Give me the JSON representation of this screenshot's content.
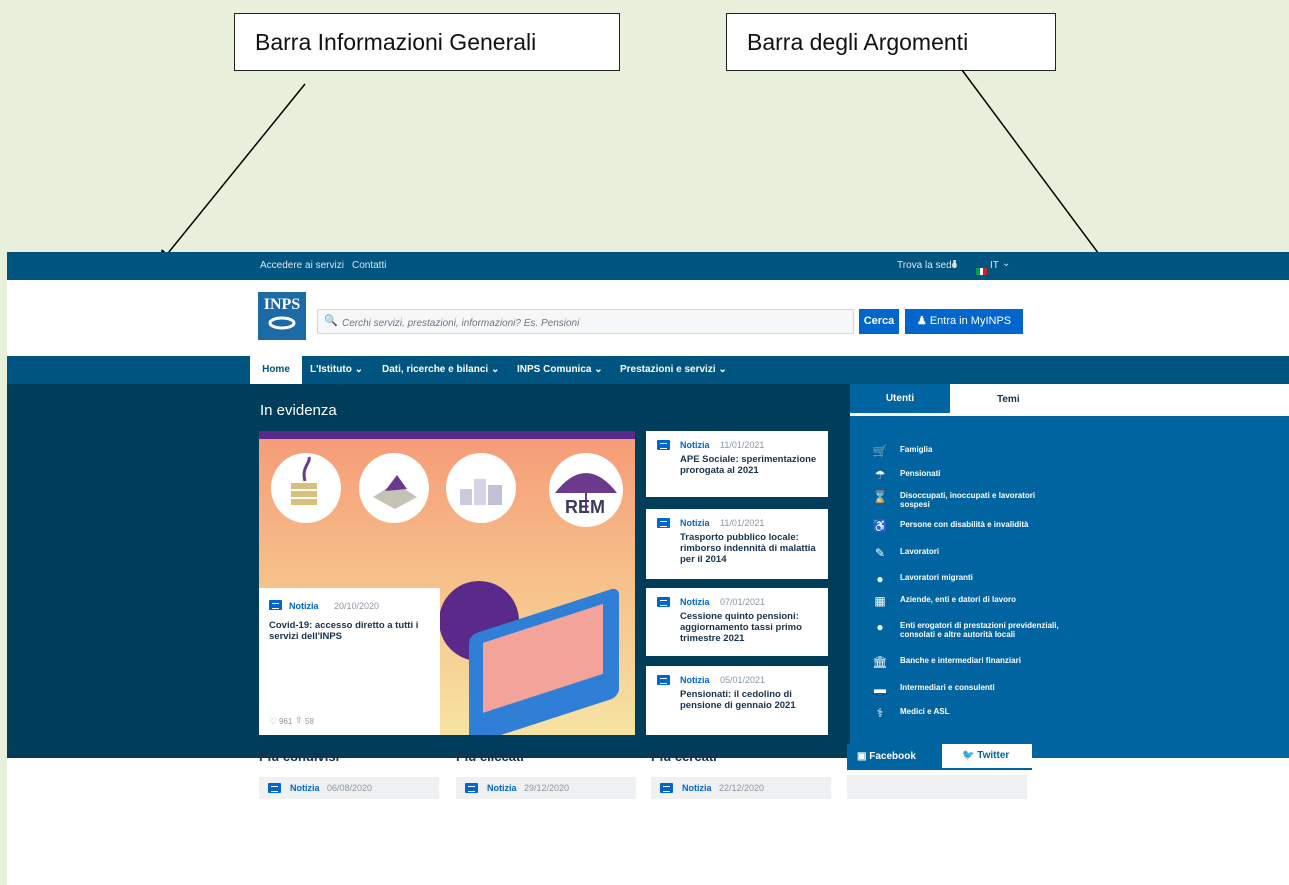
{
  "annotations": {
    "left_label": "Barra Informazioni Generali",
    "right_label": "Barra degli Argomenti"
  },
  "topbar": {
    "links": [
      "Accedere ai servizi",
      "Contatti"
    ],
    "find_office": "Trova la sede",
    "language": "IT"
  },
  "header": {
    "logo_text": "INPS",
    "search_placeholder": "Cerchi servizi, prestazioni, informazioni? Es. Pensioni",
    "search_button": "Cerca",
    "login_button": "Entra in MyINPS"
  },
  "nav": {
    "items": [
      "Home",
      "L'Istituto",
      "Dati, ricerche e bilanci",
      "INPS Comunica",
      "Prestazioni e servizi"
    ]
  },
  "hero": {
    "title": "In evidenza",
    "featured": {
      "tag": "Notizia",
      "date": "20/10/2020",
      "title": "Covid-19: accesso diretto a tutti i servizi dell'INPS",
      "likes": "961",
      "shares": "58",
      "image_badge": "REM"
    },
    "news": [
      {
        "tag": "Notizia",
        "date": "11/01/2021",
        "title": "APE Sociale: sperimentazione prorogata al 2021"
      },
      {
        "tag": "Notizia",
        "date": "11/01/2021",
        "title": "Trasporto pubblico locale: rimborso indennità di malattia per il 2014"
      },
      {
        "tag": "Notizia",
        "date": "07/01/2021",
        "title": "Cessione quinto pensioni: aggiornamento tassi primo trimestre 2021"
      },
      {
        "tag": "Notizia",
        "date": "05/01/2021",
        "title": "Pensionati: il cedolino di pensione di gennaio 2021"
      }
    ]
  },
  "sidebar": {
    "tabs": [
      "Utenti",
      "Temi"
    ],
    "items": [
      {
        "icon": "stroller-icon",
        "label": "Famiglia"
      },
      {
        "icon": "umbrella-icon",
        "label": "Pensionati"
      },
      {
        "icon": "hourglass-icon",
        "label": "Disoccupati, inoccupati e lavoratori sospesi"
      },
      {
        "icon": "wheelchair-icon",
        "label": "Persone con disabilità e invalidità"
      },
      {
        "icon": "wrench-icon",
        "label": "Lavoratori"
      },
      {
        "icon": "globe-icon",
        "label": "Lavoratori migranti"
      },
      {
        "icon": "building-icon",
        "label": "Aziende, enti e datori di lavoro"
      },
      {
        "icon": "chat-icon",
        "label": "Enti erogatori di prestazioni previdenziali, consolati e altre autorità locali"
      },
      {
        "icon": "bank-icon",
        "label": "Banche e intermediari finanziari"
      },
      {
        "icon": "briefcase-icon",
        "label": "Intermediari e consulenti"
      },
      {
        "icon": "stethoscope-icon",
        "label": "Medici e ASL"
      }
    ]
  },
  "bottom": {
    "sections": [
      {
        "title": "Più condivisi",
        "tag": "Notizia",
        "date": "06/08/2020"
      },
      {
        "title": "Più cliccati",
        "tag": "Notizia",
        "date": "29/12/2020"
      },
      {
        "title": "Più cercati",
        "tag": "Notizia",
        "date": "22/12/2020"
      }
    ],
    "social_tabs": [
      "Facebook",
      "Twitter"
    ]
  }
}
